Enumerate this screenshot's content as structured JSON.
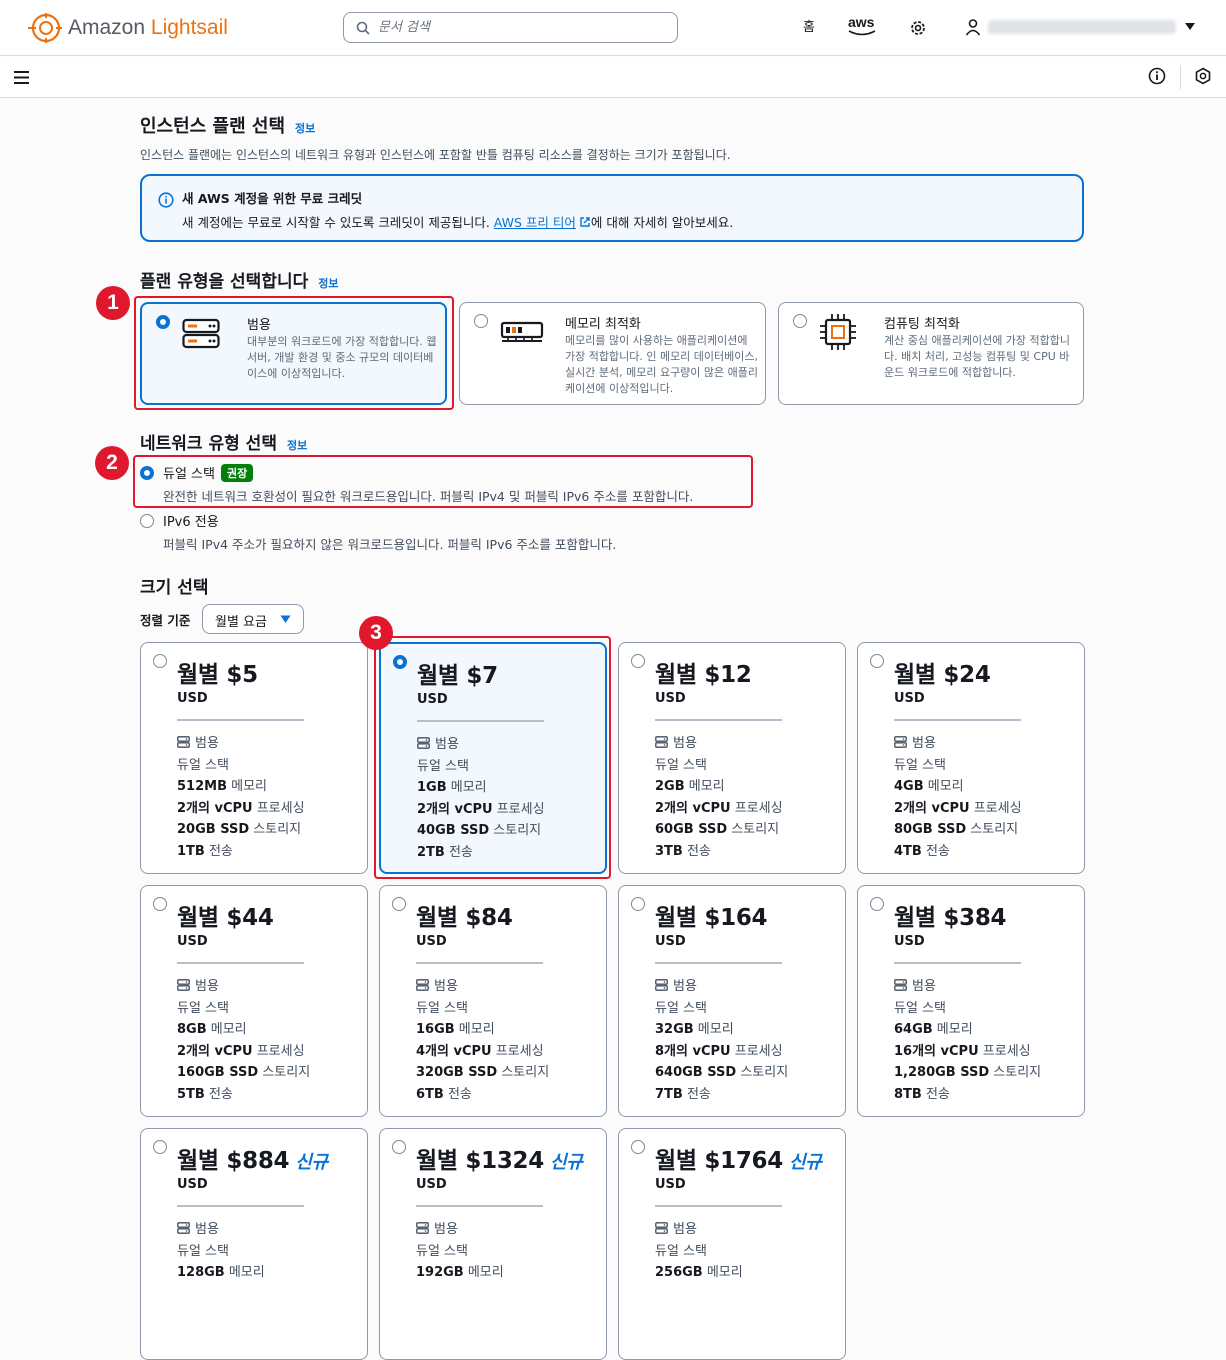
{
  "header": {
    "logo_a": "Amazon",
    "logo_b": "Lightsail",
    "search_placeholder": "문서 검색",
    "home": "홈",
    "aws": "aws"
  },
  "section1": {
    "title": "인스턴스 플랜 선택",
    "info": "정보",
    "desc": "인스턴스 플랜에는 인스턴스의 네트워크 유형과 인스턴스에 포함할 반틀 컴퓨팅 리소스를 결정하는 크기가 포함됩니다."
  },
  "alert": {
    "title": "새 AWS 계정을 위한 무료 크레딧",
    "body_pre": "새 계정에는 무료로 시작할 수 있도록 크레딧이 제공됩니다.",
    "link": "AWS 프리 티어",
    "body_post": "에 대해 자세히 알아보세요."
  },
  "plan_type": {
    "title": "플랜 유형을 선택합니다",
    "info": "정보",
    "options": [
      {
        "title": "범용",
        "desc": "대부분의 워크로드에 가장 적합합니다. 웹 서버, 개발 환경 및 중소 규모의 데이터베이스에 이상적입니다.",
        "icon": "server-icon",
        "selected": true
      },
      {
        "title": "메모리 최적화",
        "desc": "메모리를 많이 사용하는 애플리케이션에 가장 적합합니다. 인 메모리 데이터베이스, 실시간 분석, 메모리 요구량이 많은 애플리케이션에 이상적입니다.",
        "icon": "memory-icon",
        "selected": false
      },
      {
        "title": "컴퓨팅 최적화",
        "desc": "계산 중심 애플리케이션에 가장 적합합니다. 배치 처리, 고성능 컴퓨팅 및 CPU 바운드 워크로드에 적합합니다.",
        "icon": "cpu-icon",
        "selected": false
      }
    ]
  },
  "network": {
    "title": "네트워크 유형 선택",
    "info": "정보",
    "options": [
      {
        "label": "듀얼 스택",
        "badge": "권장",
        "desc": "완전한 네트워크 호환성이 필요한 워크로드용입니다. 퍼블릭 IPv4 및 퍼블릭 IPv6 주소를 포함합니다.",
        "selected": true
      },
      {
        "label": "IPv6 전용",
        "desc": "퍼블릭 IPv4 주소가 필요하지 않은 워크로드용입니다. 퍼블릭 IPv6 주소를 포함합니다.",
        "selected": false
      }
    ]
  },
  "size": {
    "title": "크기 선택",
    "sort_label": "정렬 기준",
    "sort_value": "월별 요금",
    "cards": [
      {
        "price": "월별 $5",
        "usd": "USD",
        "type": "범용",
        "net": "듀얼 스택",
        "mem_v": "512MB",
        "mem_l": " 메모리",
        "cpu_v": "2개의 vCPU",
        "cpu_l": " 프로세싱",
        "ssd_v": "20GB SSD",
        "ssd_l": " 스토리지",
        "tr_v": "1TB",
        "tr_l": " 전송",
        "selected": false,
        "new": ""
      },
      {
        "price": "월별 $7",
        "usd": "USD",
        "type": "범용",
        "net": "듀얼 스택",
        "mem_v": "1GB",
        "mem_l": " 메모리",
        "cpu_v": "2개의 vCPU",
        "cpu_l": " 프로세싱",
        "ssd_v": "40GB SSD",
        "ssd_l": " 스토리지",
        "tr_v": "2TB",
        "tr_l": " 전송",
        "selected": true,
        "new": ""
      },
      {
        "price": "월별 $12",
        "usd": "USD",
        "type": "범용",
        "net": "듀얼 스택",
        "mem_v": "2GB",
        "mem_l": " 메모리",
        "cpu_v": "2개의 vCPU",
        "cpu_l": " 프로세싱",
        "ssd_v": "60GB SSD",
        "ssd_l": " 스토리지",
        "tr_v": "3TB",
        "tr_l": " 전송",
        "selected": false,
        "new": ""
      },
      {
        "price": "월별 $24",
        "usd": "USD",
        "type": "범용",
        "net": "듀얼 스택",
        "mem_v": "4GB",
        "mem_l": " 메모리",
        "cpu_v": "2개의 vCPU",
        "cpu_l": " 프로세싱",
        "ssd_v": "80GB SSD",
        "ssd_l": " 스토리지",
        "tr_v": "4TB",
        "tr_l": " 전송",
        "selected": false,
        "new": ""
      },
      {
        "price": "월별 $44",
        "usd": "USD",
        "type": "범용",
        "net": "듀얼 스택",
        "mem_v": "8GB",
        "mem_l": " 메모리",
        "cpu_v": "2개의 vCPU",
        "cpu_l": " 프로세싱",
        "ssd_v": "160GB SSD",
        "ssd_l": " 스토리지",
        "tr_v": "5TB",
        "tr_l": " 전송",
        "selected": false,
        "new": ""
      },
      {
        "price": "월별 $84",
        "usd": "USD",
        "type": "범용",
        "net": "듀얼 스택",
        "mem_v": "16GB",
        "mem_l": " 메모리",
        "cpu_v": "4개의 vCPU",
        "cpu_l": " 프로세싱",
        "ssd_v": "320GB SSD",
        "ssd_l": " 스토리지",
        "tr_v": "6TB",
        "tr_l": " 전송",
        "selected": false,
        "new": ""
      },
      {
        "price": "월별 $164",
        "usd": "USD",
        "type": "범용",
        "net": "듀얼 스택",
        "mem_v": "32GB",
        "mem_l": " 메모리",
        "cpu_v": "8개의 vCPU",
        "cpu_l": " 프로세싱",
        "ssd_v": "640GB SSD",
        "ssd_l": " 스토리지",
        "tr_v": "7TB",
        "tr_l": " 전송",
        "selected": false,
        "new": ""
      },
      {
        "price": "월별 $384",
        "usd": "USD",
        "type": "범용",
        "net": "듀얼 스택",
        "mem_v": "64GB",
        "mem_l": " 메모리",
        "cpu_v": "16개의 vCPU",
        "cpu_l": " 프로세싱",
        "ssd_v": "1,280GB SSD",
        "ssd_l": " 스토리지",
        "tr_v": "8TB",
        "tr_l": " 전송",
        "selected": false,
        "new": ""
      },
      {
        "price": "월별 $884",
        "usd": "USD",
        "type": "범용",
        "net": "듀얼 스택",
        "mem_v": "128GB",
        "mem_l": " 메모리",
        "cpu_v": "",
        "cpu_l": "",
        "ssd_v": "",
        "ssd_l": "",
        "tr_v": "",
        "tr_l": "",
        "selected": false,
        "new": "신규"
      },
      {
        "price": "월별 $1324",
        "usd": "USD",
        "type": "범용",
        "net": "듀얼 스택",
        "mem_v": "192GB",
        "mem_l": " 메모리",
        "cpu_v": "",
        "cpu_l": "",
        "ssd_v": "",
        "ssd_l": "",
        "tr_v": "",
        "tr_l": "",
        "selected": false,
        "new": "신규"
      },
      {
        "price": "월별 $1764",
        "usd": "USD",
        "type": "범용",
        "net": "듀얼 스택",
        "mem_v": "256GB",
        "mem_l": " 메모리",
        "cpu_v": "",
        "cpu_l": "",
        "ssd_v": "",
        "ssd_l": "",
        "tr_v": "",
        "tr_l": "",
        "selected": false,
        "new": "신규"
      }
    ]
  },
  "annotations": [
    "1",
    "2",
    "3"
  ],
  "colors": {
    "accent": "#0972d3",
    "brand": "#ec7211",
    "highlight": "#e0182d",
    "recommended": "#037f0c"
  }
}
